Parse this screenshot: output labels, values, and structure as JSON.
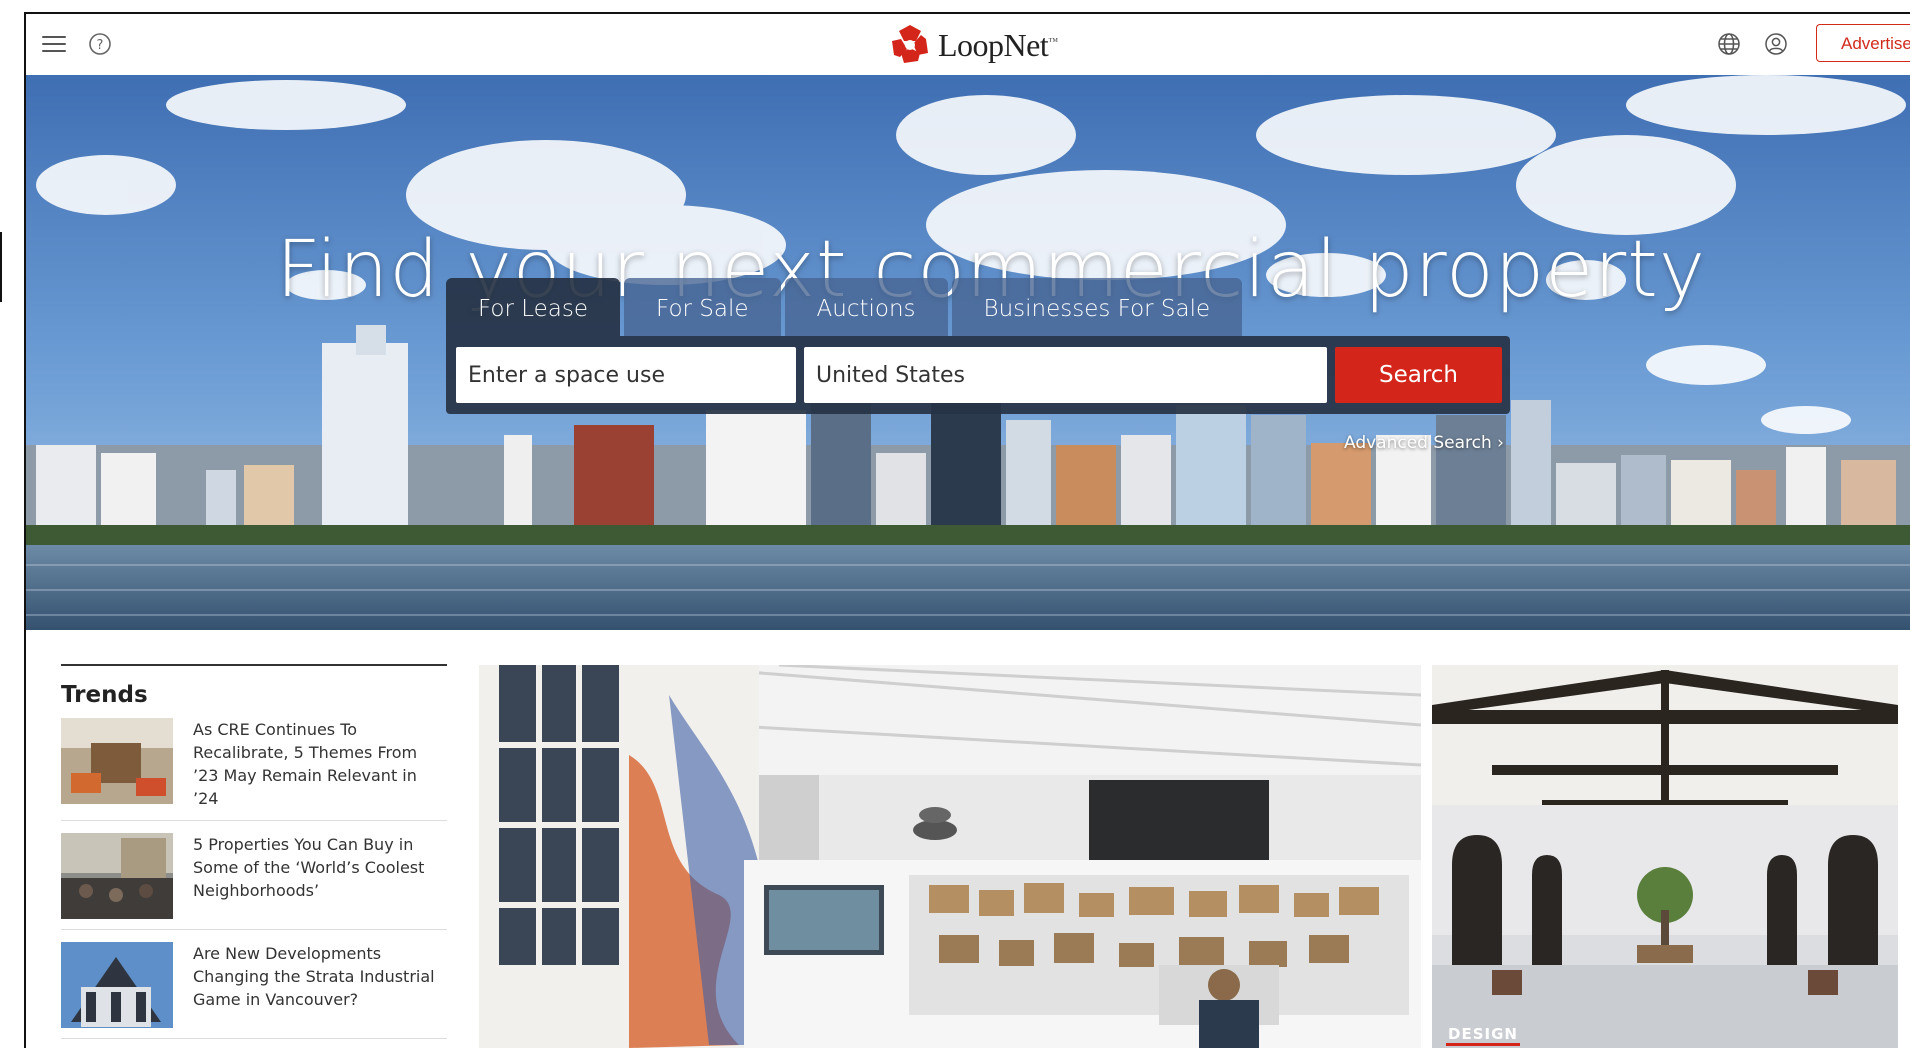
{
  "header": {
    "logo_text": "LoopNet",
    "logo_tm": "™",
    "advertise_label": "Advertise",
    "icons": [
      "menu-icon",
      "help-icon",
      "globe-icon",
      "user-icon"
    ]
  },
  "hero": {
    "title": "Find your next commercial property",
    "tabs": [
      {
        "label": "For Lease",
        "active": true
      },
      {
        "label": "For Sale",
        "active": false
      },
      {
        "label": "Auctions",
        "active": false
      },
      {
        "label": "Businesses For Sale",
        "active": false
      }
    ],
    "space_use_placeholder": "Enter a space use",
    "location_value": "United States",
    "search_label": "Search",
    "advanced_label": "Advanced Search ›"
  },
  "trends": {
    "title": "Trends",
    "items": [
      {
        "text": "As CRE Continues To Recalibrate, 5 Themes From ’23 May Remain Relevant in ’24"
      },
      {
        "text": "5 Properties You Can Buy in Some of the ‘World’s Coolest Neighborhoods’"
      },
      {
        "text": "Are New Developments Changing the Strata Industrial Game in Vancouver?"
      }
    ]
  },
  "features": {
    "side_tag": "DESIGN"
  },
  "colors": {
    "brand_red": "#d4251a",
    "search_panel": "#263244",
    "tab_inactive": "#466491"
  }
}
